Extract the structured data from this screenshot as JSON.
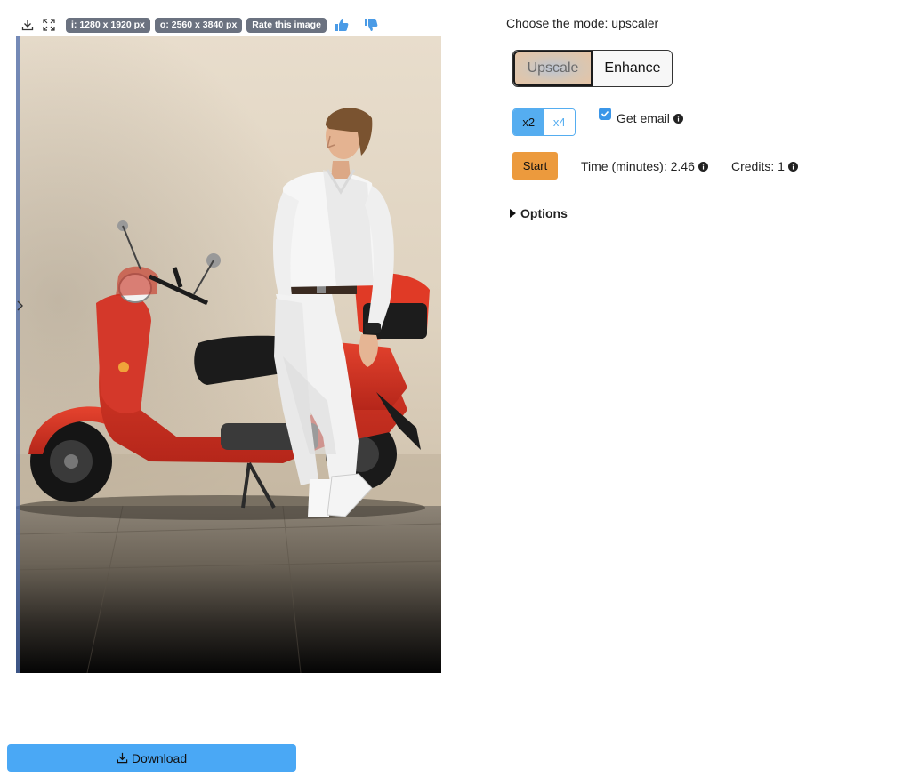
{
  "toolbar": {
    "download_icon": "download-icon",
    "fullscreen_icon": "fullscreen-icon",
    "input_size": "i: 1280 x 1920 px",
    "output_size": "o: 2560 x 3840 px",
    "rate_label": "Rate this image",
    "thumbs_up_icon": "thumbs-up-icon",
    "thumbs_down_icon": "thumbs-down-icon"
  },
  "settings": {
    "mode_label": "Choose the mode: upscaler",
    "modes": [
      {
        "label": "Upscale",
        "selected": true
      },
      {
        "label": "Enhance",
        "selected": false
      }
    ],
    "scales": [
      {
        "label": "x2",
        "selected": true
      },
      {
        "label": "x4",
        "selected": false
      }
    ],
    "email_label": "Get email",
    "email_checked": true,
    "start_label": "Start",
    "time_label": "Time (minutes): 2.46",
    "credits_label": "Credits: 1",
    "options_label": "Options"
  },
  "download": {
    "label": "Download"
  },
  "colors": {
    "accent_blue": "#4aa8f5",
    "start_orange": "#ec9a3d",
    "badge_gray": "#6b7280",
    "checkbox_blue": "#3b96e8"
  }
}
